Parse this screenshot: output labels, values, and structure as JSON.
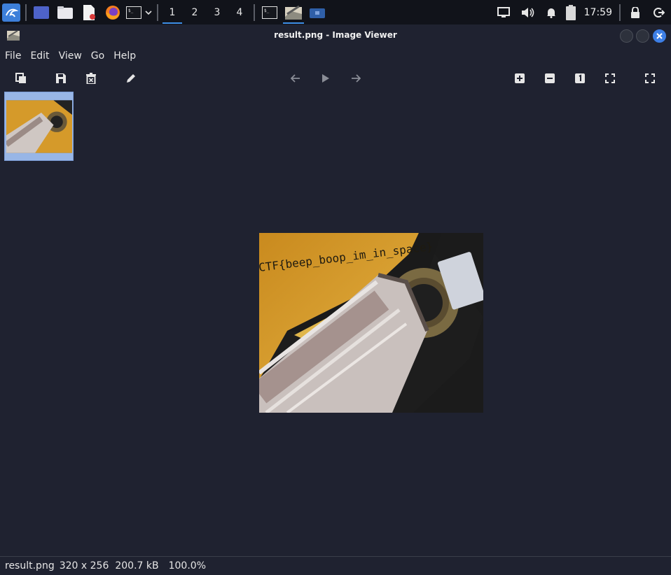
{
  "panel": {
    "workspaces": [
      "1",
      "2",
      "3",
      "4"
    ],
    "active_workspace": "1",
    "clock": "17:59",
    "tray_icons": [
      "display-icon",
      "volume-icon",
      "bell-icon",
      "battery-icon",
      "lock-icon",
      "logout-icon"
    ]
  },
  "window": {
    "title": "result.png - Image Viewer"
  },
  "menu": {
    "items": [
      "File",
      "Edit",
      "View",
      "Go",
      "Help"
    ]
  },
  "image": {
    "flag_text": "CTF{beep_boop_im_in_space}"
  },
  "status": {
    "filename": "result.png",
    "dimensions": "320 x 256",
    "filesize": "200.7 kB",
    "zoom": "100.0%"
  },
  "colors": {
    "accent": "#3d8ee6",
    "window_bg": "#1f2230",
    "panel_bg": "#11131a",
    "thumb_selected": "#98b6e6"
  }
}
